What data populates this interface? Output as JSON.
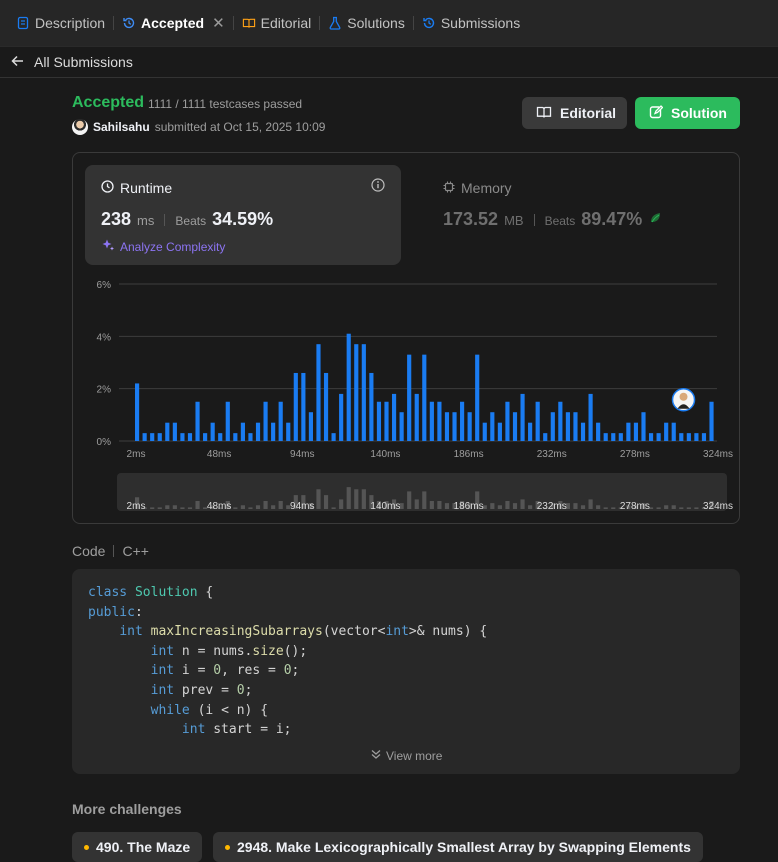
{
  "tabs": [
    {
      "label": "Description",
      "icon": "description-icon"
    },
    {
      "label": "Accepted",
      "icon": "history-icon",
      "active": true
    },
    {
      "label": "Editorial",
      "icon": "book-icon"
    },
    {
      "label": "Solutions",
      "icon": "flask-icon"
    },
    {
      "label": "Submissions",
      "icon": "history-icon"
    }
  ],
  "back_label": "All Submissions",
  "submission": {
    "status": "Accepted",
    "testcases": "1111 / 1111 testcases passed",
    "username": "Sahilsahu",
    "submitted": "submitted at Oct 15, 2025 10:09"
  },
  "buttons": {
    "editorial": "Editorial",
    "solution": "Solution"
  },
  "runtime": {
    "label": "Runtime",
    "value": "238",
    "unit": "ms",
    "beats_label": "Beats",
    "beats": "34.59%",
    "analyze": "Analyze Complexity"
  },
  "memory": {
    "label": "Memory",
    "value": "173.52",
    "unit": "MB",
    "beats_label": "Beats",
    "beats": "89.47%"
  },
  "colors": {
    "accent_green": "#2cbb5d",
    "bar_blue": "#1a7cf2",
    "analyze_purple": "#8c74f2"
  },
  "chart_data": {
    "type": "bar",
    "x_ticks": [
      "2ms",
      "48ms",
      "94ms",
      "140ms",
      "186ms",
      "232ms",
      "278ms",
      "324ms"
    ],
    "y_ticks": [
      "6%",
      "4%",
      "2%",
      "0%"
    ],
    "ylim": [
      0,
      6
    ],
    "grid": true,
    "highlight_index": 76,
    "values": [
      2.2,
      0.3,
      0.3,
      0.3,
      0.7,
      0.7,
      0.3,
      0.3,
      1.5,
      0.3,
      0.7,
      0.3,
      1.5,
      0.3,
      0.7,
      0.3,
      0.7,
      1.5,
      0.7,
      1.5,
      0.7,
      2.6,
      2.6,
      1.1,
      3.7,
      2.6,
      0.3,
      1.8,
      4.1,
      3.7,
      3.7,
      2.6,
      1.5,
      1.5,
      1.8,
      1.1,
      3.3,
      1.8,
      3.3,
      1.5,
      1.5,
      1.1,
      1.1,
      1.5,
      1.1,
      3.3,
      0.7,
      1.1,
      0.7,
      1.5,
      1.1,
      1.8,
      0.7,
      1.5,
      0.3,
      1.1,
      1.5,
      1.1,
      1.1,
      0.7,
      1.8,
      0.7,
      0.3,
      0.3,
      0.3,
      0.7,
      0.7,
      1.1,
      0.3,
      0.3,
      0.7,
      0.7,
      0.3,
      0.3,
      0.3,
      0.3,
      1.5
    ]
  },
  "code": {
    "label": "Code",
    "language": "C++",
    "view_more": "View more",
    "lines": [
      [
        [
          "kw",
          "class"
        ],
        [
          "",
          " "
        ],
        [
          "cls",
          "Solution"
        ],
        [
          "",
          " {"
        ]
      ],
      [
        [
          "kw",
          "public"
        ],
        [
          "",
          ":"
        ]
      ],
      [
        [
          "",
          "    "
        ],
        [
          "kw",
          "int"
        ],
        [
          "",
          " "
        ],
        [
          "fn",
          "maxIncreasingSubarrays"
        ],
        [
          "",
          "(vector<"
        ],
        [
          "kw",
          "int"
        ],
        [
          "",
          ">& nums) {"
        ]
      ],
      [
        [
          "",
          "        "
        ],
        [
          "kw",
          "int"
        ],
        [
          "",
          " n = nums."
        ],
        [
          "fn",
          "size"
        ],
        [
          "",
          "();"
        ]
      ],
      [
        [
          "",
          "        "
        ],
        [
          "kw",
          "int"
        ],
        [
          "",
          " i = "
        ],
        [
          "num",
          "0"
        ],
        [
          "",
          ", res = "
        ],
        [
          "num",
          "0"
        ],
        [
          "",
          ";"
        ]
      ],
      [
        [
          "",
          "        "
        ],
        [
          "kw",
          "int"
        ],
        [
          "",
          " prev = "
        ],
        [
          "num",
          "0"
        ],
        [
          "",
          ";"
        ]
      ],
      [
        [
          "",
          "        "
        ],
        [
          "kw",
          "while"
        ],
        [
          "",
          " (i < n) {"
        ]
      ],
      [
        [
          "",
          "            "
        ],
        [
          "kw",
          "int"
        ],
        [
          "",
          " start = i;"
        ]
      ]
    ]
  },
  "more": {
    "title": "More challenges",
    "items": [
      "490. The Maze",
      "2948. Make Lexicographically Smallest Array by Swapping Elements"
    ]
  }
}
